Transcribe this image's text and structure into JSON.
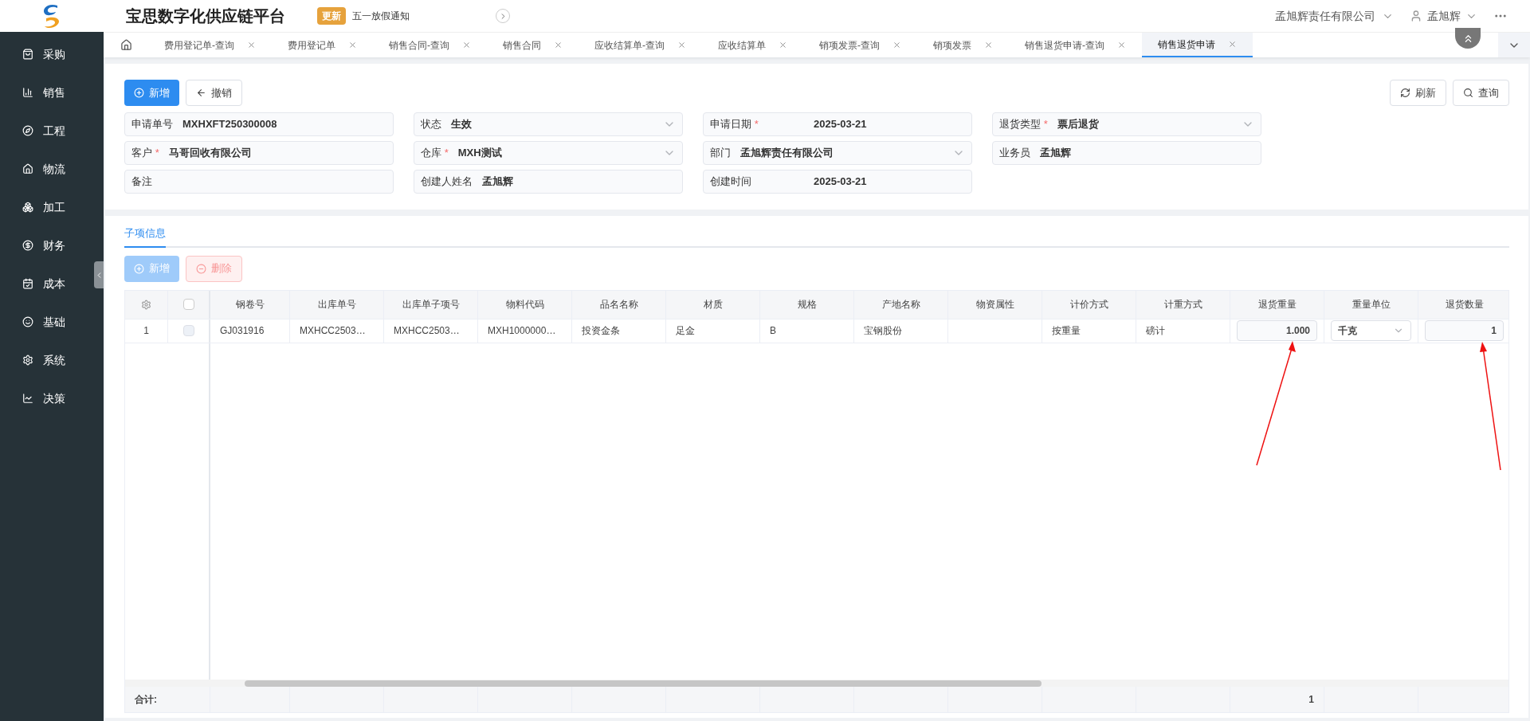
{
  "header": {
    "title": "宝思数字化供应链平台",
    "badge": "更新",
    "notice": "五一放假通知",
    "company": "孟旭辉责任有限公司",
    "user": "孟旭辉"
  },
  "sidebar": {
    "items": [
      {
        "label": "采购",
        "selected": false
      },
      {
        "label": "销售",
        "selected": false
      },
      {
        "label": "工程",
        "selected": false
      },
      {
        "label": "物流",
        "selected": false
      },
      {
        "label": "加工",
        "selected": false
      },
      {
        "label": "财务",
        "selected": false
      },
      {
        "label": "成本",
        "selected": false
      },
      {
        "label": "基础",
        "selected": false
      },
      {
        "label": "系统",
        "selected": false
      },
      {
        "label": "决策",
        "selected": false
      }
    ]
  },
  "tabs": [
    {
      "label": "费用登记单-查询",
      "selected": false
    },
    {
      "label": "费用登记单",
      "selected": false
    },
    {
      "label": "销售合同-查询",
      "selected": false
    },
    {
      "label": "销售合同",
      "selected": false
    },
    {
      "label": "应收结算单-查询",
      "selected": false
    },
    {
      "label": "应收结算单",
      "selected": false
    },
    {
      "label": "销项发票-查询",
      "selected": false
    },
    {
      "label": "销项发票",
      "selected": false
    },
    {
      "label": "销售退货申请-查询",
      "selected": false
    },
    {
      "label": "销售退货申请",
      "selected": true
    }
  ],
  "toolbar": {
    "left": [
      {
        "label": "新增",
        "kind": "add"
      },
      {
        "label": "撤销",
        "kind": "back"
      }
    ],
    "right": [
      {
        "label": "刷新",
        "kind": "refresh"
      },
      {
        "label": "查询",
        "kind": "search"
      }
    ]
  },
  "form": {
    "fields": [
      {
        "label": "申请单号",
        "value": "MXHXFT250300008",
        "kind": "text"
      },
      {
        "label": "状态",
        "value": "生效",
        "kind": "select"
      },
      {
        "label": "申请日期",
        "mark": "*",
        "value": "2025-03-21",
        "kind": "date"
      },
      {
        "label": "退货类型",
        "mark": "*",
        "value": "票后退货",
        "kind": "select"
      },
      {
        "label": "客户",
        "mark": "*",
        "value": "马哥回收有限公司",
        "kind": "text"
      },
      {
        "label": "仓库",
        "mark": "*",
        "value": "MXH测试",
        "kind": "select"
      },
      {
        "label": "部门",
        "value": "孟旭辉责任有限公司",
        "kind": "select"
      },
      {
        "label": "业务员",
        "value": "孟旭辉",
        "kind": "text"
      },
      {
        "label": "备注",
        "kind": "text"
      },
      {
        "label": "创建人姓名",
        "value": "孟旭辉",
        "kind": "text"
      },
      {
        "label": "创建时间",
        "value": "2025-03-21",
        "kind": "date"
      }
    ]
  },
  "section": {
    "tabs": [
      {
        "label": "子项信息",
        "selected": true
      }
    ],
    "buttons": [
      {
        "label": "新增",
        "kind": "add",
        "disabled": true
      },
      {
        "label": "删除",
        "kind": "delete",
        "disabled": true
      }
    ]
  },
  "table": {
    "select_all_checked": false,
    "columns": [
      {
        "label": "钢卷号"
      },
      {
        "label": "出库单号"
      },
      {
        "label": "出库单子项号"
      },
      {
        "label": "物料代码"
      },
      {
        "label": "品名名称"
      },
      {
        "label": "材质"
      },
      {
        "label": "规格"
      },
      {
        "label": "产地名称"
      },
      {
        "label": "物资属性"
      },
      {
        "label": "计价方式"
      },
      {
        "label": "计重方式"
      },
      {
        "label": "退货重量",
        "total": "1"
      },
      {
        "label": "重量单位"
      },
      {
        "label": "退货数量"
      }
    ],
    "rows": [
      {
        "index": "1",
        "checked": false,
        "cells": [
          {
            "kind": "text",
            "value": "GJ031916"
          },
          {
            "kind": "text",
            "value": "MXHCC2503…"
          },
          {
            "kind": "text",
            "value": "MXHCC2503…"
          },
          {
            "kind": "text",
            "value": "MXH1000000…"
          },
          {
            "kind": "text",
            "value": "投资金条"
          },
          {
            "kind": "text",
            "value": "足金"
          },
          {
            "kind": "text",
            "value": "B"
          },
          {
            "kind": "text",
            "value": "宝钢股份"
          },
          {
            "kind": "text"
          },
          {
            "kind": "text",
            "value": "按重量"
          },
          {
            "kind": "text",
            "value": "磅计"
          },
          {
            "kind": "input",
            "value": "1.000"
          },
          {
            "kind": "select",
            "value": "千克"
          },
          {
            "kind": "input",
            "value": "1"
          }
        ]
      }
    ],
    "footer": {
      "label": "合计:"
    }
  }
}
